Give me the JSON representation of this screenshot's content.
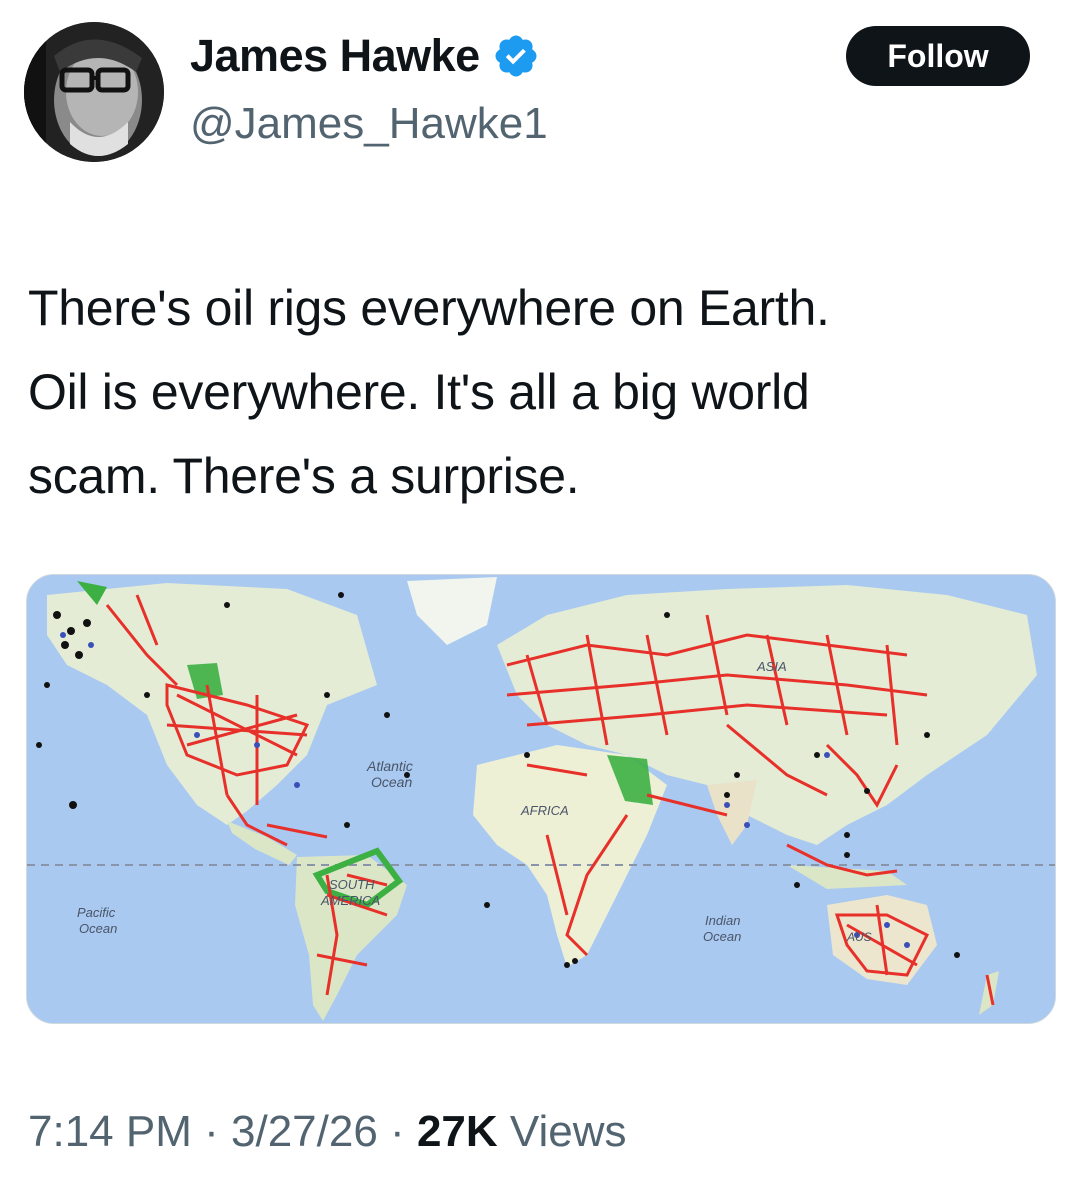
{
  "author": {
    "name": "James Hawke",
    "handle": "@James_Hawke1",
    "verified": true,
    "verified_color": "#1d9bf0"
  },
  "follow_button": {
    "label": "Follow"
  },
  "tweet": {
    "lines": [
      "There's oil rigs everywhere on Earth.",
      "Oil is everywhere.  It's all a big world",
      "scam.  There's a surprise."
    ]
  },
  "media": {
    "labels": {
      "atlantic_1": "Atlantic",
      "atlantic_2": "Ocean",
      "pacific_1": "Pacific",
      "pacific_2": "Ocean",
      "indian_1": "Indian",
      "indian_2": "Ocean",
      "africa": "AFRICA",
      "south_america_1": "SOUTH",
      "south_america_2": "AMERICA",
      "asia": "ASIA",
      "australia": "AUS"
    },
    "colors": {
      "ocean": "#a9c9f0",
      "land": "#e9eed9",
      "pipeline": "#e8302a",
      "region": "#3cb043"
    }
  },
  "meta": {
    "time": "7:14 PM",
    "separator": "·",
    "date": "3/27/26",
    "views_count": "27K",
    "views_label": "Views"
  }
}
